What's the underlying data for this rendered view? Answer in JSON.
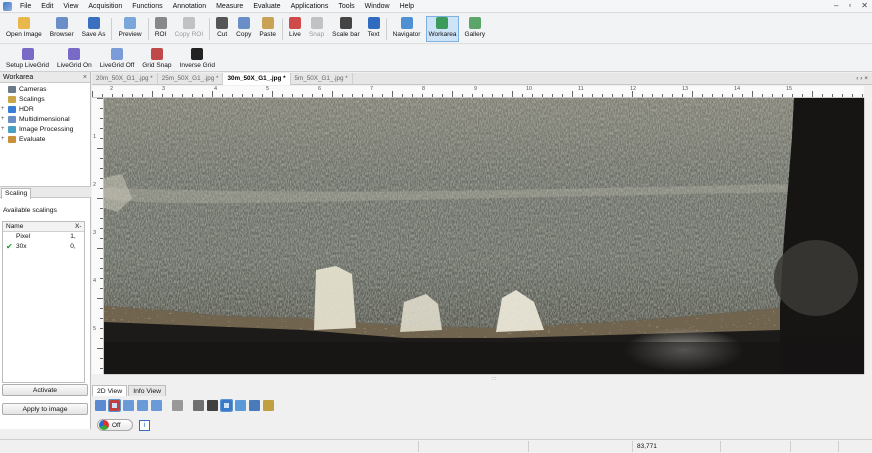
{
  "menu": {
    "items": [
      "File",
      "Edit",
      "View",
      "Acquisition",
      "Functions",
      "Annotation",
      "Measure",
      "Evaluate",
      "Applications",
      "Tools",
      "Window",
      "Help"
    ]
  },
  "toolbar_main": {
    "buttons": [
      {
        "label": "Open Image",
        "icon": "open-image-icon",
        "color": "#e8b84a"
      },
      {
        "label": "Browser",
        "icon": "browser-icon",
        "color": "#6a8fc8"
      },
      {
        "label": "Save As",
        "icon": "save-icon",
        "color": "#3b6fbf"
      },
      {
        "label": "Preview",
        "icon": "preview-icon",
        "color": "#7aa7d9"
      },
      {
        "label": "ROI",
        "icon": "roi-icon",
        "color": "#888888"
      },
      {
        "label": "Copy ROI",
        "icon": "copy-roi-icon",
        "color": "#888888",
        "disabled": true
      },
      {
        "label": "Cut",
        "icon": "cut-icon",
        "color": "#555555"
      },
      {
        "label": "Copy",
        "icon": "copy-icon",
        "color": "#6a8fc8"
      },
      {
        "label": "Paste",
        "icon": "paste-icon",
        "color": "#c9a256"
      },
      {
        "label": "Live",
        "icon": "live-icon",
        "color": "#d04a4a"
      },
      {
        "label": "Snap",
        "icon": "snap-icon",
        "color": "#888888",
        "disabled": true
      },
      {
        "label": "Scale bar",
        "icon": "scale-bar-icon",
        "color": "#444444"
      },
      {
        "label": "Text",
        "icon": "text-icon",
        "color": "#2f6cc0"
      },
      {
        "label": "Navigator",
        "icon": "navigator-icon",
        "color": "#4e90d1"
      },
      {
        "label": "Workarea",
        "icon": "workarea-icon",
        "color": "#3c9a5a",
        "active": true
      },
      {
        "label": "Gallery",
        "icon": "gallery-icon",
        "color": "#5aa56a"
      }
    ]
  },
  "toolbar_grid": {
    "buttons": [
      {
        "label": "Setup LiveGrid",
        "icon": "setup-livegrid-icon",
        "color": "#7a6ac8"
      },
      {
        "label": "LiveGrid On",
        "icon": "livegrid-on-icon",
        "color": "#7a6ac8"
      },
      {
        "label": "LiveGrid Off",
        "icon": "livegrid-off-icon",
        "color": "#7a9ad8"
      },
      {
        "label": "Grid Snap",
        "icon": "grid-snap-icon",
        "color": "#c04a4a"
      },
      {
        "label": "Inverse Grid",
        "icon": "inverse-grid-icon",
        "color": "#222222"
      }
    ]
  },
  "workarea": {
    "title": "Workarea",
    "close": "×",
    "tree": [
      {
        "label": "Cameras",
        "icon": "camera-icon",
        "color": "#6b7a8a",
        "expander": ""
      },
      {
        "label": "Scalings",
        "icon": "scalings-icon",
        "color": "#c9a54a",
        "expander": ""
      },
      {
        "label": "HDR",
        "icon": "hdr-icon",
        "color": "#3a7bd5",
        "expander": "+"
      },
      {
        "label": "Multidimensional",
        "icon": "multidimensional-icon",
        "color": "#6a8fc8",
        "expander": "+"
      },
      {
        "label": "Image Processing",
        "icon": "image-processing-icon",
        "color": "#4aa0c0",
        "expander": "+"
      },
      {
        "label": "Evaluate",
        "icon": "evaluate-icon",
        "color": "#c98f3a",
        "expander": "+"
      }
    ]
  },
  "scaling_panel": {
    "tab": "Scaling",
    "available_label": "Available scalings",
    "col_name": "Name",
    "col_x": "X-",
    "rows": [
      {
        "name": "Pixel",
        "value": "1,",
        "checked": false
      },
      {
        "name": "30x",
        "value": "0,",
        "checked": true
      }
    ],
    "activate_label": "Activate",
    "apply_label": "Apply to image"
  },
  "doc_tabs": [
    {
      "label": "20m_50X_G1_.jpg *",
      "active": false
    },
    {
      "label": "25m_50X_G1_.jpg *",
      "active": false
    },
    {
      "label": "30m_50X_G1_.jpg *",
      "active": true
    },
    {
      "label": "5m_50X_G1_.jpg *",
      "active": false
    }
  ],
  "doc_tab_nav": "‹ › ×",
  "view_tabs": [
    {
      "label": "2D View",
      "active": true
    },
    {
      "label": "Info View",
      "active": false
    }
  ],
  "view_tools": [
    {
      "icon": "select-icon",
      "color": "#5b8ad0"
    },
    {
      "icon": "pan-icon",
      "color": "#c04040",
      "active": true
    },
    {
      "icon": "zoom-in-icon",
      "color": "#6a9ad8"
    },
    {
      "icon": "zoom-out-icon",
      "color": "#6a9ad8"
    },
    {
      "icon": "zoom-fit-icon",
      "color": "#6a9ad8"
    },
    {
      "icon": "roi-tool-icon",
      "color": "#999999"
    },
    {
      "icon": "globe-icon",
      "color": "#707070"
    },
    {
      "icon": "measure-icon",
      "color": "#404040"
    },
    {
      "icon": "grid-tool-icon",
      "color": "#3a78c8",
      "active": true
    },
    {
      "icon": "overlay-icon",
      "color": "#5a9ad8"
    },
    {
      "icon": "layers-icon",
      "color": "#4a7ab8"
    },
    {
      "icon": "pen-icon",
      "color": "#c0a040"
    }
  ],
  "off_toggle_label": "Off",
  "info_button": "i",
  "status": {
    "coordinate": "83,771"
  },
  "ruler": {
    "top_labels": [
      "2",
      "3",
      "4",
      "5",
      "6",
      "7",
      "8",
      "9",
      "10",
      "11",
      "12",
      "13",
      "14",
      "15"
    ],
    "left_labels": [
      "1",
      "2",
      "3",
      "4",
      "5"
    ]
  }
}
